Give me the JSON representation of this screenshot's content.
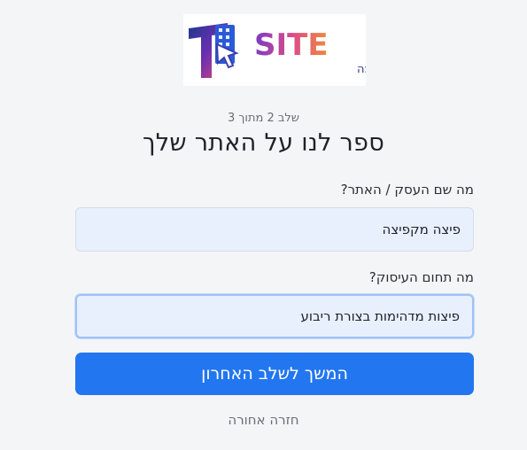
{
  "logo": {
    "brand_text": "SITE",
    "tagline": "בניית אתרים חכמה"
  },
  "step_indicator": "שלב 2 מתוך 3",
  "title": "ספר לנו על האתר שלך",
  "form": {
    "business_name": {
      "label": "מה שם העסק / האתר?",
      "value": "פיצה מקפיצה"
    },
    "business_field": {
      "label": "מה תחום העיסוק?",
      "value": "פיצות מדהימות בצורת ריבוע"
    }
  },
  "continue_button": "המשך לשלב האחרון",
  "back_link": "חזרה אחורה",
  "colors": {
    "primary": "#2276f0",
    "background": "#f4f5f7",
    "input_fill": "#e8f0fe"
  }
}
